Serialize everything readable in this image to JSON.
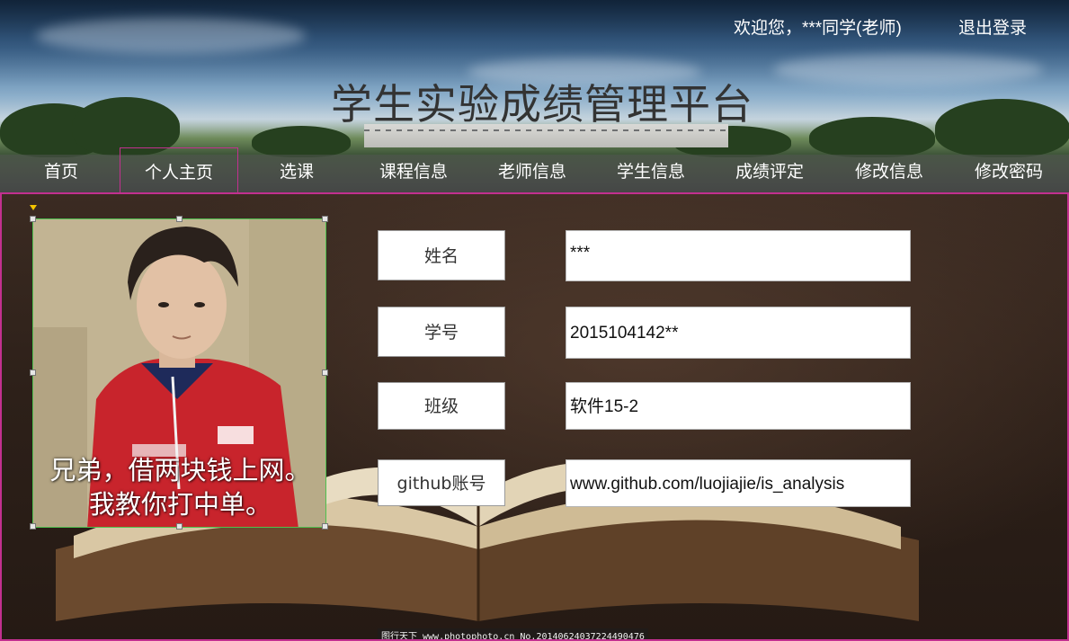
{
  "header": {
    "greeting": "欢迎您，***同学(老师)",
    "logout_label": "退出登录",
    "site_title": "学生实验成绩管理平台"
  },
  "nav": {
    "items": [
      {
        "label": "首页"
      },
      {
        "label": "个人主页",
        "active": true
      },
      {
        "label": "选课"
      },
      {
        "label": "课程信息"
      },
      {
        "label": "老师信息"
      },
      {
        "label": "学生信息"
      },
      {
        "label": "成绩评定"
      },
      {
        "label": "修改信息"
      },
      {
        "label": "修改密码"
      }
    ]
  },
  "profile": {
    "photo_caption_line1": "兄弟，借两块钱上网。",
    "photo_caption_line2": "我教你打中单。",
    "fields": [
      {
        "label": "姓名",
        "value": "***"
      },
      {
        "label": "学号",
        "value": "2015104142**"
      },
      {
        "label": "班级",
        "value": "软件15-2"
      },
      {
        "label": "github账号",
        "value": "www.github.com/luojiajie/is_analysis"
      }
    ]
  },
  "watermark": "图行天下 www.photophoto.cn No.20140624037224490476",
  "colors": {
    "accent_border": "#c2308f",
    "photo_border": "#4fc14f"
  }
}
